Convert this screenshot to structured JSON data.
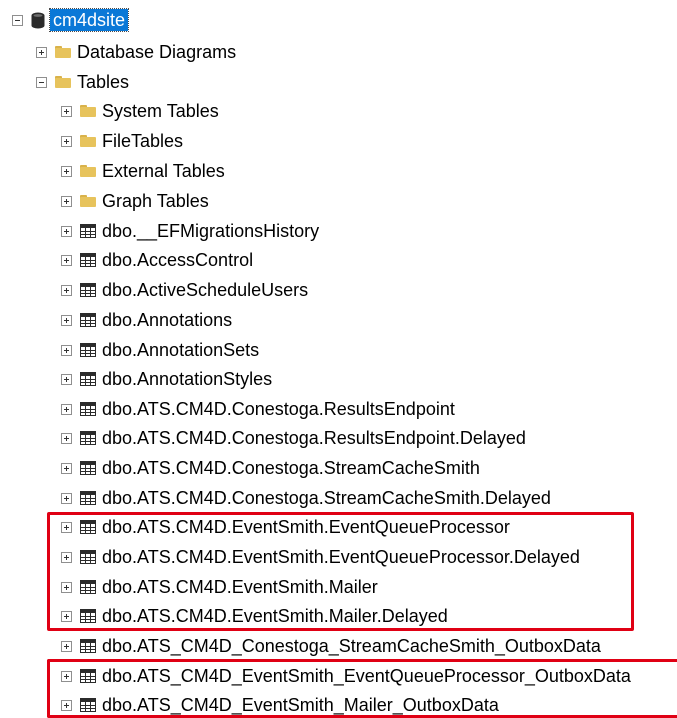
{
  "colors": {
    "selection": "#0a78d7",
    "highlight_box": "#e00014",
    "folder": "#e7c35c"
  },
  "tree": {
    "database": {
      "label": "cm4dsite",
      "state": "expanded",
      "icon": "database-icon"
    },
    "folders": [
      {
        "label": "Database Diagrams",
        "state": "collapsed",
        "icon": "folder-icon"
      },
      {
        "label": "Tables",
        "state": "expanded",
        "icon": "folder-icon"
      }
    ],
    "table_folders": [
      {
        "label": "System Tables",
        "state": "collapsed",
        "icon": "folder-icon"
      },
      {
        "label": "FileTables",
        "state": "collapsed",
        "icon": "folder-icon"
      },
      {
        "label": "External Tables",
        "state": "collapsed",
        "icon": "folder-icon"
      },
      {
        "label": "Graph Tables",
        "state": "collapsed",
        "icon": "folder-icon"
      }
    ],
    "tables": [
      {
        "label": "dbo.__EFMigrationsHistory",
        "highlighted": false
      },
      {
        "label": "dbo.AccessControl",
        "highlighted": false
      },
      {
        "label": "dbo.ActiveScheduleUsers",
        "highlighted": false
      },
      {
        "label": "dbo.Annotations",
        "highlighted": false
      },
      {
        "label": "dbo.AnnotationSets",
        "highlighted": false
      },
      {
        "label": "dbo.AnnotationStyles",
        "highlighted": false
      },
      {
        "label": "dbo.ATS.CM4D.Conestoga.ResultsEndpoint",
        "highlighted": false
      },
      {
        "label": "dbo.ATS.CM4D.Conestoga.ResultsEndpoint.Delayed",
        "highlighted": false
      },
      {
        "label": "dbo.ATS.CM4D.Conestoga.StreamCacheSmith",
        "highlighted": false
      },
      {
        "label": "dbo.ATS.CM4D.Conestoga.StreamCacheSmith.Delayed",
        "highlighted": false
      },
      {
        "label": "dbo.ATS.CM4D.EventSmith.EventQueueProcessor",
        "highlighted": true
      },
      {
        "label": "dbo.ATS.CM4D.EventSmith.EventQueueProcessor.Delayed",
        "highlighted": true
      },
      {
        "label": "dbo.ATS.CM4D.EventSmith.Mailer",
        "highlighted": true
      },
      {
        "label": "dbo.ATS.CM4D.EventSmith.Mailer.Delayed",
        "highlighted": true
      },
      {
        "label": "dbo.ATS_CM4D_Conestoga_StreamCacheSmith_OutboxData",
        "highlighted": false
      },
      {
        "label": "dbo.ATS_CM4D_EventSmith_EventQueueProcessor_OutboxData",
        "highlighted": true
      },
      {
        "label": "dbo.ATS_CM4D_EventSmith_Mailer_OutboxData",
        "highlighted": true
      }
    ]
  }
}
